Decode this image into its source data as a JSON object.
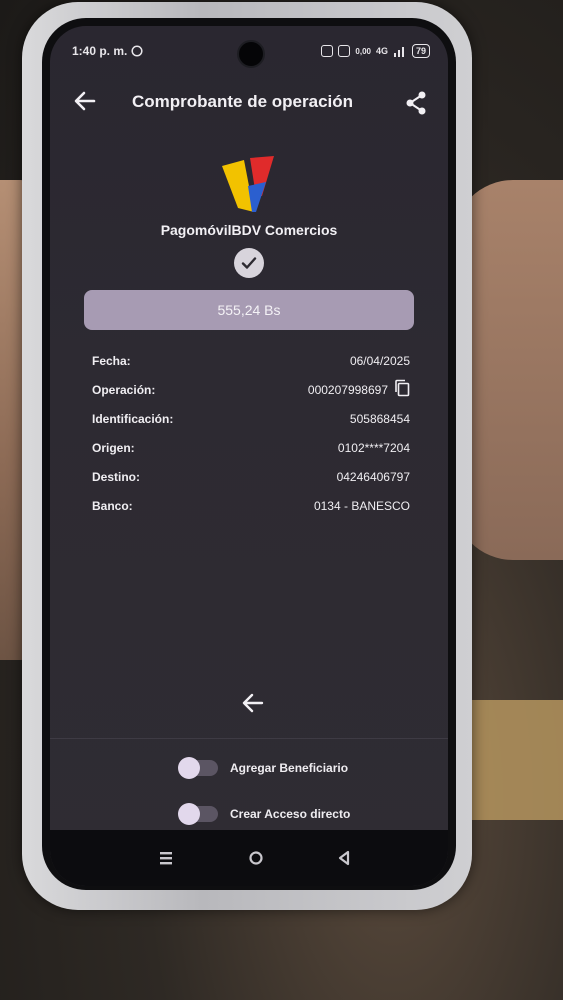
{
  "status_bar": {
    "time": "1:40 p. m.",
    "network_speed": "0,00",
    "signal_label": "4G",
    "battery": "79"
  },
  "header": {
    "title": "Comprobante de operación"
  },
  "brand": {
    "name": "PagomóvilBDV Comercios"
  },
  "amount": "555,24 Bs",
  "details": [
    {
      "label": "Fecha:",
      "value": "06/04/2025"
    },
    {
      "label": "Operación:",
      "value": "000207998697"
    },
    {
      "label": "Identificación:",
      "value": "505868454"
    },
    {
      "label": "Origen:",
      "value": "0102****7204"
    },
    {
      "label": "Destino:",
      "value": "04246406797"
    },
    {
      "label": "Banco:",
      "value": "0134 - BANESCO"
    }
  ],
  "toggles": {
    "add_beneficiary": "Agregar Beneficiario",
    "create_shortcut": "Crear Acceso directo"
  },
  "icons": [
    "back-arrow-icon",
    "share-icon",
    "check-icon",
    "copy-icon",
    "menu-icon",
    "home-icon",
    "back-triangle-icon"
  ],
  "colors": {
    "screen_bg": "#2d2a32",
    "amount_bg": "#a79bb3",
    "logo_yellow": "#f2c200",
    "logo_red": "#e02b2b",
    "logo_blue": "#2b5fcf"
  }
}
